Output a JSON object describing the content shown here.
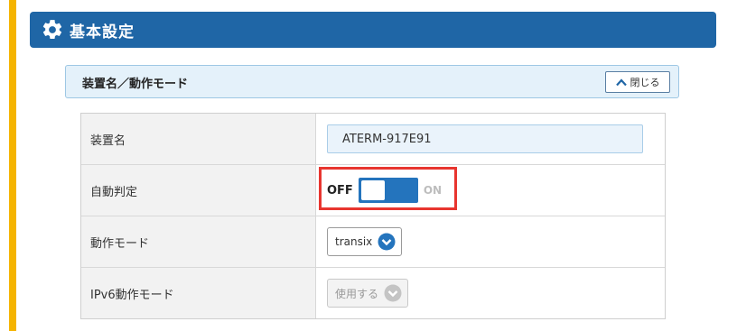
{
  "header": {
    "title": "基本設定",
    "icon": "gear-icon"
  },
  "section": {
    "title": "装置名／動作モード",
    "close_label": "閉じる"
  },
  "rows": {
    "device_name": {
      "label": "装置名",
      "value": "ATERM-917E91"
    },
    "auto_detect": {
      "label": "自動判定",
      "off_label": "OFF",
      "on_label": "ON",
      "state": "OFF"
    },
    "mode": {
      "label": "動作モード",
      "selected": "transix"
    },
    "ipv6_mode": {
      "label": "IPv6動作モード",
      "selected": "使用する",
      "disabled": true
    }
  },
  "colors": {
    "accent": "#f5b400",
    "header": "#1f66a6",
    "toggle": "#2474bd",
    "highlight": "#e8352f"
  }
}
